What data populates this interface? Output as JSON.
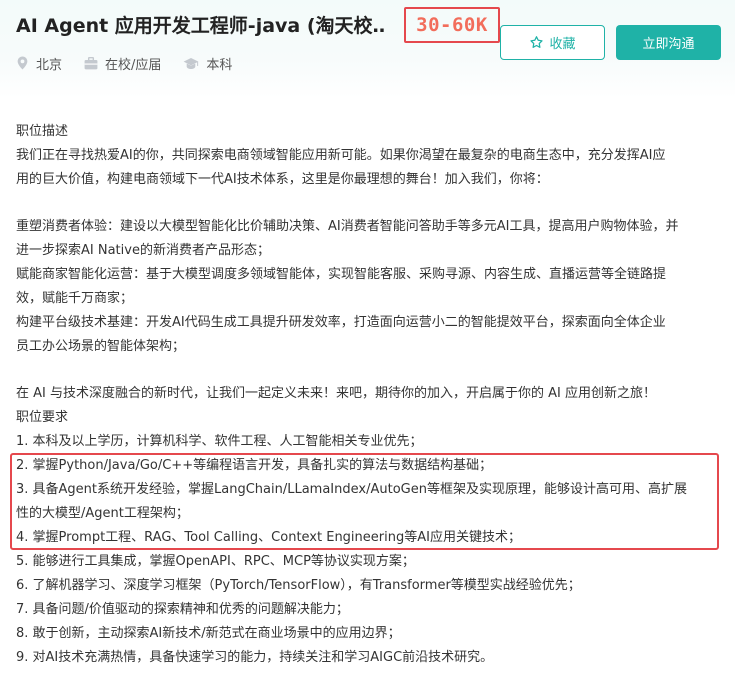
{
  "job": {
    "title": "AI Agent 应用开发工程师-java (淘天校…",
    "salary": "30-60K",
    "meta": {
      "location": "北京",
      "type": "在校/应届",
      "degree": "本科"
    },
    "favorite_label": "收藏",
    "chat_label": "立即沟通"
  },
  "description": {
    "heading": "职位描述",
    "intro": [
      "我们正在寻找热爱AI的你，共同探索电商领域智能应用新可能。如果你渴望在最复杂的电商生态中，充分发挥AI应",
      "用的巨大价值，构建电商领域下一代AI技术体系，这里是你最理想的舞台！加入我们，你将："
    ],
    "duties": [
      "重塑消费者体验：建设以大模型智能化比价辅助决策、AI消费者智能问答助手等多元AI工具，提高用户购物体验，并",
      "进一步探索AI Native的新消费者产品形态；",
      "赋能商家智能化运营：基于大模型调度多领域智能体，实现智能客服、采购寻源、内容生成、直播运营等全链路提",
      "效，赋能千万商家；",
      "构建平台级技术基建：开发AI代码生成工具提升研发效率，打造面向运营小二的智能提效平台，探索面向全体企业",
      "员工办公场景的智能体架构；"
    ],
    "closing": "在 AI 与技术深度融合的新时代，让我们一起定义未来！来吧，期待你的加入，开启属于你的 AI 应用创新之旅！"
  },
  "requirements": {
    "heading": "职位要求",
    "items": [
      "1. 本科及以上学历，计算机科学、软件工程、人工智能相关专业优先；",
      "2. 掌握Python/Java/Go/C++等编程语言开发，具备扎实的算法与数据结构基础；",
      "3. 具备Agent系统开发经验，掌握LangChain/LLamaIndex/AutoGen等框架及实现原理，能够设计高可用、高扩展",
      "性的大模型/Agent工程架构；",
      "4. 掌握Prompt工程、RAG、Tool Calling、Context Engineering等AI应用关键技术；",
      "5. 能够进行工具集成，掌握OpenAPI、RPC、MCP等协议实现方案；",
      "6. 了解机器学习、深度学习框架（PyTorch/TensorFlow），有Transformer等模型实战经验优先；",
      "7. 具备问题/价值驱动的探索精神和优秀的问题解决能力；",
      "8. 敢于创新，主动探索AI新技术/新范式在商业场景中的应用边界；",
      "9. 对AI技术充满热情，具备快速学习的能力，持续关注和学习AIGC前沿技术研究。"
    ]
  },
  "colors": {
    "accent": "#1fb2a7",
    "salary": "#f26d5b",
    "annotation": "#e5484d"
  }
}
